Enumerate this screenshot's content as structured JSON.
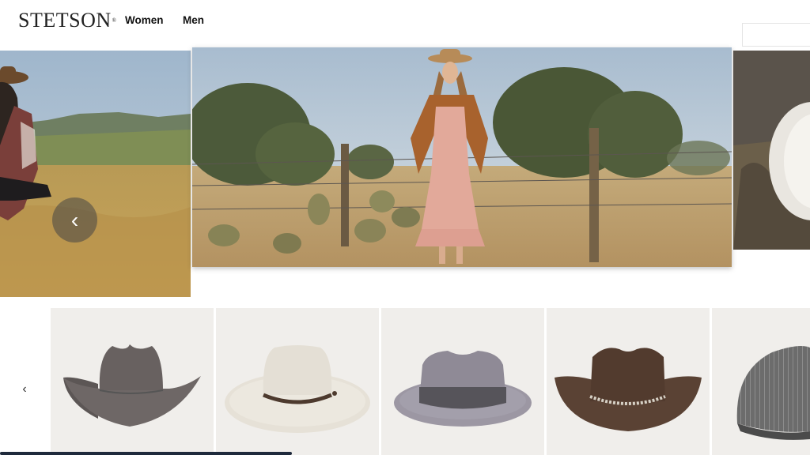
{
  "header": {
    "logo": "STETSON",
    "logo_mark": "®",
    "nav": [
      {
        "label": "Women"
      },
      {
        "label": "Men"
      }
    ]
  },
  "hero_carousel": {
    "prev_icon": "chevron-left-icon",
    "prev_glyph": "‹"
  },
  "products": {
    "prev_icon": "chevron-left-icon",
    "prev_glyph": "‹",
    "items": [
      {
        "type": "cattleman-cowboy-hat",
        "color": "#6e6766"
      },
      {
        "type": "gambler-hat",
        "color": "#e6e1d7"
      },
      {
        "type": "fedora",
        "color": "#8f8a96"
      },
      {
        "type": "cowboy-hat",
        "color": "#5a4234"
      },
      {
        "type": "newsboy-cap",
        "color": "#6c6c6c"
      }
    ]
  },
  "scroll_progress": 0.36
}
